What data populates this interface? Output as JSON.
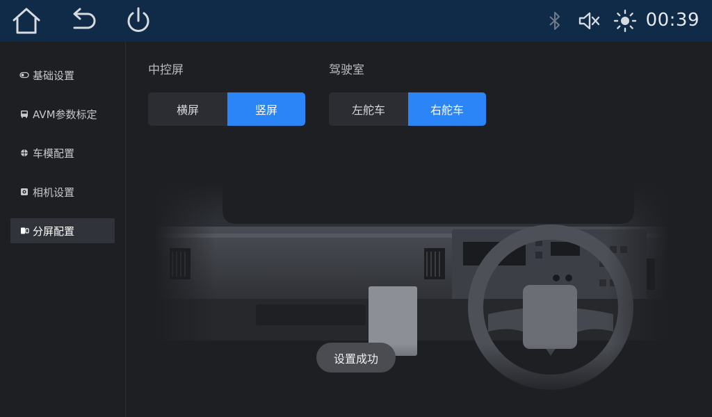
{
  "topbar": {
    "home_icon": "home-icon",
    "back_icon": "back-icon",
    "power_icon": "power-icon",
    "bluetooth_icon": "bluetooth-icon",
    "mute_icon": "volume-mute-icon",
    "brightness_icon": "brightness-icon",
    "clock": "00:39",
    "background": "#0f2b47"
  },
  "sidebar": {
    "items": [
      {
        "label": "基础设置",
        "icon": "toggle-icon",
        "active": false
      },
      {
        "label": "AVM参数标定",
        "icon": "bus-icon",
        "active": false
      },
      {
        "label": "车模配置",
        "icon": "car-model-icon",
        "active": false
      },
      {
        "label": "相机设置",
        "icon": "camera-icon",
        "active": false
      },
      {
        "label": "分屏配置",
        "icon": "split-screen-icon",
        "active": true
      }
    ]
  },
  "main": {
    "screen_group": {
      "label": "中控屏",
      "options": [
        "横屏",
        "竖屏"
      ],
      "selected": "竖屏"
    },
    "cab_group": {
      "label": "驾驶室",
      "options": [
        "左舵车",
        "右舵车"
      ],
      "selected": "右舵车"
    },
    "toast": "设置成功"
  },
  "colors": {
    "accent": "#2b85f6",
    "background": "#1e1f23",
    "sidebar_active": "#303339"
  }
}
